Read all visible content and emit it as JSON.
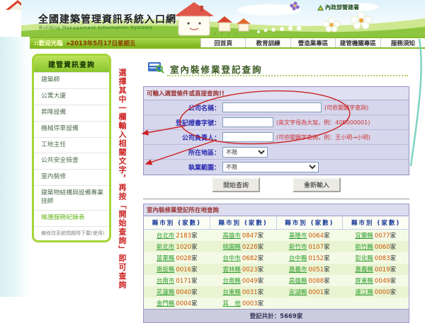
{
  "colors": {
    "accent_green": "#8cc63f",
    "nav_border_green": "#86bb2a",
    "annotation_red": "#cc2222",
    "county_link_green": "#2f9e2f",
    "count_orange": "#cc5500",
    "form_label_blue": "#2b2bb0",
    "hint_red": "#cc3333",
    "section_title_maroon": "#993333",
    "column_header_blue": "#1a3a99"
  },
  "header": {
    "site_title": "全國建築管理資訊系統入口網",
    "site_subtitle": "Building Management Information Systems",
    "agency_label": "內政部營建署",
    "welcome_label": "::歡迎光臨",
    "date_label": "▸2013年5月17日星期五"
  },
  "nav": {
    "items": [
      {
        "key": "home",
        "label": "回首頁"
      },
      {
        "key": "education-training",
        "label": "教育訓練"
      },
      {
        "key": "construction-industry",
        "label": "營造業專區"
      },
      {
        "key": "building-authority",
        "label": "建管機關專區"
      },
      {
        "key": "service-notice",
        "label": "服務須知"
      }
    ]
  },
  "sidebar": {
    "title": "建管資訊查詢",
    "items": [
      {
        "key": "architect",
        "label": "建築師",
        "style": "normal"
      },
      {
        "key": "apartment-building",
        "label": "公寓大廈",
        "style": "normal"
      },
      {
        "key": "elevator-equipment",
        "label": "昇降設備",
        "style": "normal"
      },
      {
        "key": "mechanical-parking",
        "label": "機械停車設備",
        "style": "normal"
      },
      {
        "key": "site-director",
        "label": "工地主任",
        "style": "normal"
      },
      {
        "key": "public-safety-inspection",
        "label": "公共安全檢查",
        "style": "normal"
      },
      {
        "key": "interior-renovation",
        "label": "室內裝修",
        "style": "normal"
      },
      {
        "key": "structure-equipment-engineer",
        "label": "建築物結構與設備專業技師",
        "style": "normal"
      },
      {
        "key": "maintenance-record-form",
        "label": "維護服務紀錄表",
        "style": "highlight"
      },
      {
        "key": "system-download-note",
        "label": "備修改系統問題時下載(使用)",
        "style": "note"
      }
    ]
  },
  "main": {
    "page_title": "室內裝修業登記查詢",
    "form": {
      "header": "可輸入適當條件或直接查詢!!",
      "fields": [
        {
          "key": "company-name",
          "label": "公司名稱：",
          "type": "text",
          "value": "",
          "hint": "(可依關鍵字查詢)"
        },
        {
          "key": "certificate-number",
          "label": "登記證書字號：",
          "type": "text",
          "value": "",
          "hint": "(英文字母為大寫，例：40B000001)"
        },
        {
          "key": "company-owner",
          "label": "公司負責人：",
          "type": "text",
          "value": "",
          "hint": "(可依關鍵字查詢，例：王小明→小明)"
        },
        {
          "key": "location",
          "label": "所在地區：",
          "type": "select",
          "value": "不限",
          "hint": ""
        },
        {
          "key": "business-scope",
          "label": "執業範圍：",
          "type": "select",
          "value": "不限",
          "hint": ""
        }
      ],
      "search_button": "開始查詢",
      "reset_button": "重新輸入"
    },
    "annotation": {
      "vertical_text": "選擇其中一欄輸入相關文字，再按「開始查詢」即可查詢"
    },
    "table": {
      "section_title": "室內裝修業登記所在地查詢",
      "column_header": "縣市別 (家數)",
      "unit": "家",
      "rows": [
        [
          {
            "name": "台北市",
            "count": "2183"
          },
          {
            "name": "高雄市",
            "count": "0847"
          },
          {
            "name": "基隆市",
            "count": "0064"
          },
          {
            "name": "宜蘭縣",
            "count": "0077"
          }
        ],
        [
          {
            "name": "新北市",
            "count": "1020"
          },
          {
            "name": "桃園縣",
            "count": "0228"
          },
          {
            "name": "新竹市",
            "count": "0107"
          },
          {
            "name": "新竹縣",
            "count": "0060"
          }
        ],
        [
          {
            "name": "苗栗縣",
            "count": "0028"
          },
          {
            "name": "台中市",
            "count": "0682"
          },
          {
            "name": "台中縣",
            "count": "0152"
          },
          {
            "name": "彰化縣",
            "count": "0083"
          }
        ],
        [
          {
            "name": "南投縣",
            "count": "0016"
          },
          {
            "name": "雲林縣",
            "count": "0023"
          },
          {
            "name": "嘉義市",
            "count": "0051"
          },
          {
            "name": "嘉義縣",
            "count": "0019"
          }
        ],
        [
          {
            "name": "台南市",
            "count": "0171"
          },
          {
            "name": "台南縣",
            "count": "0049"
          },
          {
            "name": "高雄縣",
            "count": "0088"
          },
          {
            "name": "屏東縣",
            "count": "0049"
          }
        ],
        [
          {
            "name": "花蓮縣",
            "count": "0040"
          },
          {
            "name": "台東縣",
            "count": "0031"
          },
          {
            "name": "澎湖縣",
            "count": "0001"
          },
          {
            "name": "連江縣",
            "count": "0000"
          }
        ],
        [
          {
            "name": "金門縣",
            "count": "0004"
          },
          {
            "name": "其　他",
            "count": "0003"
          },
          null,
          null
        ]
      ],
      "total": "登記共計：5669家"
    }
  }
}
